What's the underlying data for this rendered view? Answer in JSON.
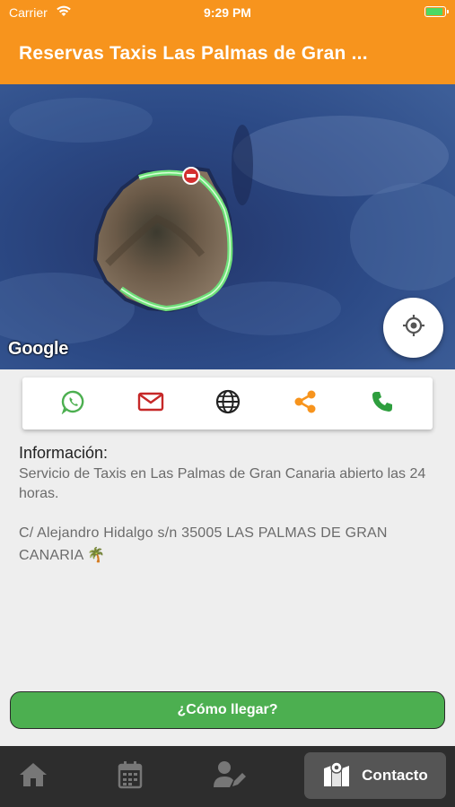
{
  "status_bar": {
    "carrier": "Carrier",
    "time": "9:29 PM",
    "battery_level": 1.0
  },
  "app_bar": {
    "title": "Reservas Taxis Las Palmas de Gran ..."
  },
  "map": {
    "attribution": "Google"
  },
  "actions": [
    {
      "name": "whatsapp-icon",
      "color": "#4caf50"
    },
    {
      "name": "mail-icon",
      "color": "#c62828"
    },
    {
      "name": "globe-icon",
      "color": "#222222"
    },
    {
      "name": "share-icon",
      "color": "#f7941d"
    },
    {
      "name": "phone-icon",
      "color": "#2e9e3e"
    }
  ],
  "info": {
    "heading": "Información:",
    "description": "Servicio de Taxis en Las Palmas de Gran Canaria abierto las 24 horas.",
    "address": "C/ Alejandro Hidalgo s/n 35005 LAS PALMAS DE GRAN CANARIA 🌴"
  },
  "route_button": {
    "label": "¿Cómo llegar?"
  },
  "bottom_nav": {
    "items": [
      {
        "icon": "home-icon"
      },
      {
        "icon": "calendar-icon"
      },
      {
        "icon": "user-edit-icon"
      },
      {
        "icon": "map-icon",
        "label": "Contacto",
        "active": true
      }
    ]
  },
  "colors": {
    "accent": "#f7941d",
    "primary_button": "#4caf50",
    "nav_bg": "#2d2d2d"
  }
}
